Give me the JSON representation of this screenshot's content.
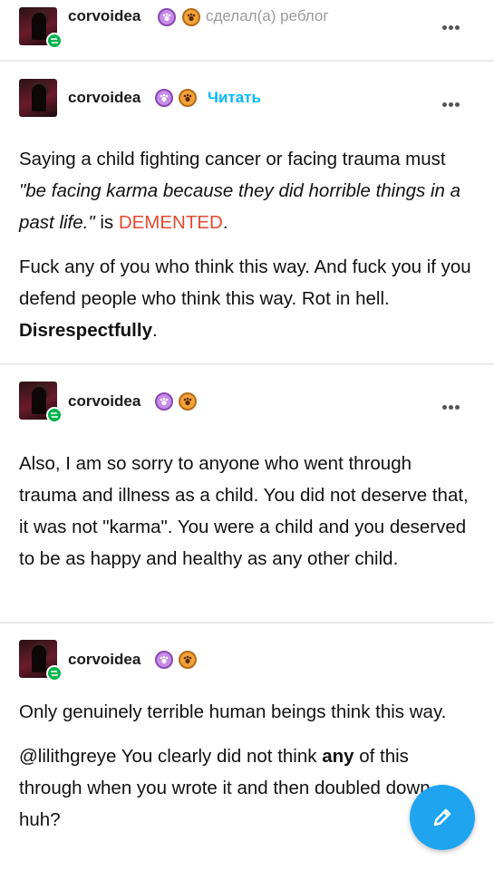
{
  "username": "corvoidea",
  "reblogged_text": "сделал(а) реблог",
  "follow_label": "Читать",
  "icons": {
    "more": "more-horizontal-icon",
    "reblog": "reblog-icon",
    "badge1": "purple-paw-badge-icon",
    "badge2": "orange-paw-badge-icon",
    "edit": "pencil-icon"
  },
  "colors": {
    "accent": "#00b8ff",
    "highlight": "#e5492f",
    "reblog_green": "#00b34d",
    "fab": "#1fa4f0"
  },
  "post1": {
    "p1_pre": "Saying a child fighting cancer or facing trauma must ",
    "p1_quote": "\"be facing karma because they did horrible things in a past life.\"",
    "p1_is": " is ",
    "p1_emph": "DEMENTED",
    "p1_end": ".",
    "p2_text": "Fuck any of you who think this way. And fuck you if you defend people who think this way. Rot in hell. ",
    "p2_bold": "Disrespectfully",
    "p2_end": "."
  },
  "post2": {
    "text": "Also, I am so sorry to anyone who went through trauma and illness as a child. You did not deserve that, it was not \"karma\". You were a child and you deserved to be as happy and healthy as any other child."
  },
  "post3": {
    "p1": "Only genuinely terrible human beings think this way.",
    "p2_pre": "@lilithgreye You clearly did not think ",
    "p2_bold": "any",
    "p2_post": " of this through when you wrote it and then doubled down, huh?"
  }
}
